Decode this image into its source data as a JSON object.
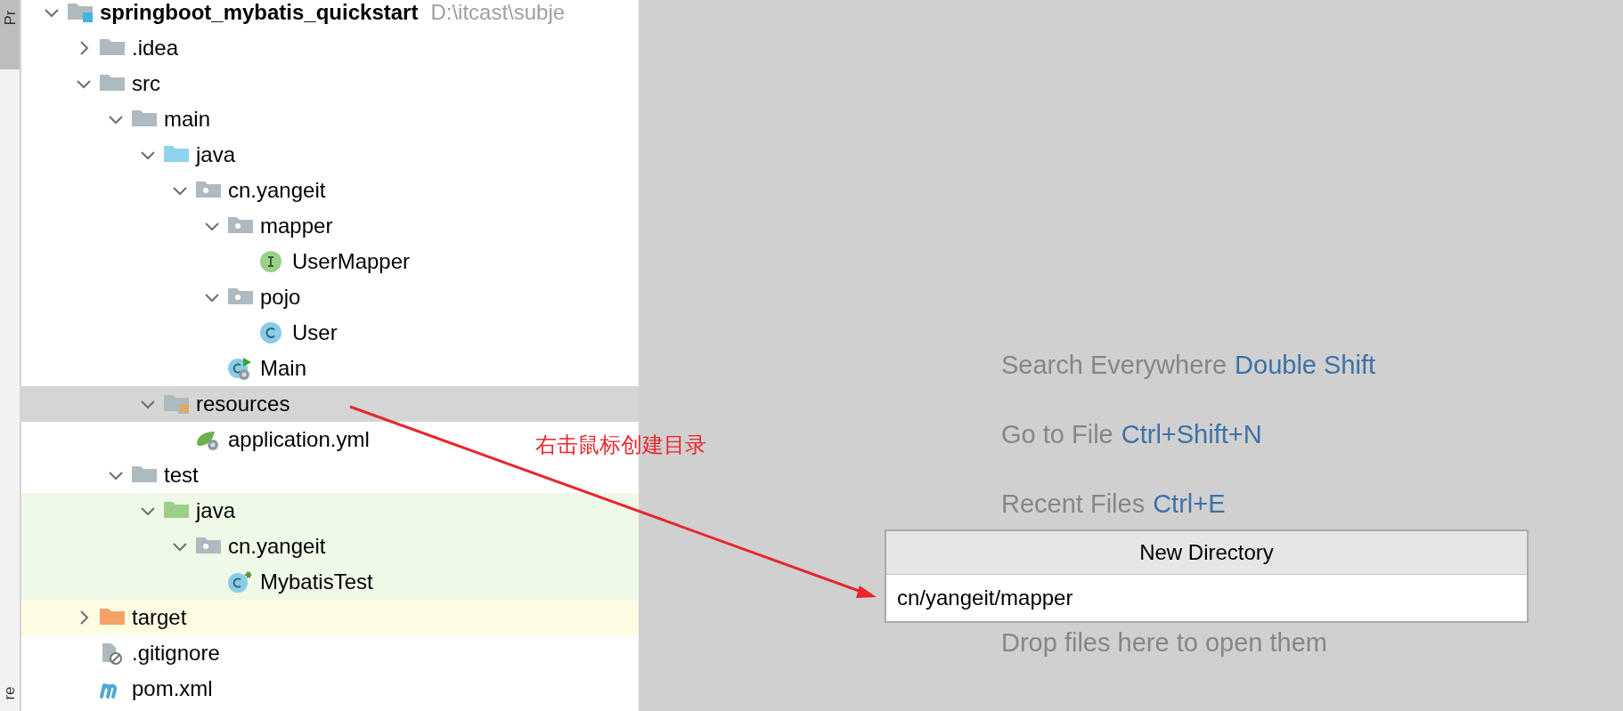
{
  "tool_stripe": {
    "labels": [
      {
        "text": "Pr",
        "selected": true
      },
      {
        "text": "re",
        "selected": false
      }
    ]
  },
  "project_tree": {
    "items": [
      {
        "name": "springboot_mybatis_quickstart",
        "path": "D:\\itcast\\subje",
        "kind": "module",
        "expanded": true,
        "selected": false,
        "children": [
          {
            "name": ".idea",
            "kind": "folder",
            "expanded": false,
            "selected": false
          },
          {
            "name": "src",
            "kind": "folder",
            "expanded": true,
            "selected": false,
            "children": [
              {
                "name": "main",
                "kind": "folder",
                "expanded": true,
                "selected": false,
                "children": [
                  {
                    "name": "java",
                    "kind": "source",
                    "expanded": true,
                    "selected": false,
                    "children": [
                      {
                        "name": "cn.yangeit",
                        "kind": "package",
                        "expanded": true,
                        "selected": false,
                        "children": [
                          {
                            "name": "mapper",
                            "kind": "package",
                            "expanded": true,
                            "selected": false,
                            "children": [
                              {
                                "name": "UserMapper",
                                "kind": "interface",
                                "selected": false
                              }
                            ]
                          },
                          {
                            "name": "pojo",
                            "kind": "package",
                            "expanded": true,
                            "selected": false,
                            "children": [
                              {
                                "name": "User",
                                "kind": "class",
                                "selected": false
                              }
                            ]
                          },
                          {
                            "name": "Main",
                            "kind": "main-class",
                            "selected": false
                          }
                        ]
                      }
                    ]
                  },
                  {
                    "name": "resources",
                    "kind": "resources",
                    "expanded": true,
                    "selected": true,
                    "children": [
                      {
                        "name": "application.yml",
                        "kind": "spring-config",
                        "selected": false
                      }
                    ]
                  }
                ]
              },
              {
                "name": "test",
                "kind": "folder",
                "expanded": true,
                "selected": false,
                "children": [
                  {
                    "name": "java",
                    "kind": "test-source",
                    "test_scope": true,
                    "expanded": true,
                    "selected": false,
                    "children": [
                      {
                        "name": "cn.yangeit",
                        "kind": "package",
                        "test_scope": true,
                        "expanded": true,
                        "selected": false,
                        "children": [
                          {
                            "name": "MybatisTest",
                            "kind": "test-class",
                            "test_scope": true,
                            "selected": false
                          }
                        ]
                      }
                    ]
                  }
                ]
              }
            ]
          },
          {
            "name": "target",
            "kind": "excluded",
            "excluded": true,
            "expanded": false,
            "selected": false
          },
          {
            "name": ".gitignore",
            "kind": "ignore-file",
            "selected": false
          },
          {
            "name": "pom.xml",
            "kind": "maven",
            "selected": false
          }
        ]
      }
    ]
  },
  "editor_empty_state": {
    "hints": [
      {
        "text": "Search Everywhere",
        "shortcut": "Double Shift"
      },
      {
        "text": "Go to File",
        "shortcut": "Ctrl+Shift+N"
      },
      {
        "text": "Recent Files",
        "shortcut": "Ctrl+E"
      },
      {
        "text": "Drop files here to open them"
      }
    ]
  },
  "new_directory_popup": {
    "title": "New Directory",
    "value": "cn/yangeit/mapper"
  },
  "annotation": {
    "text": "右击鼠标创建目录"
  }
}
